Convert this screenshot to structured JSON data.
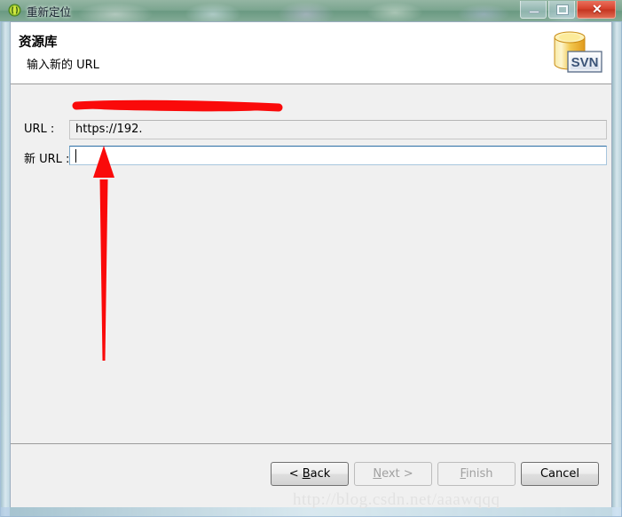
{
  "window": {
    "title": "重新定位",
    "icon": "svn-relocate-icon",
    "controls": {
      "minimize": "minimize-button",
      "maximize": "restore-button",
      "close_glyph": "✕"
    }
  },
  "header": {
    "title": "资源库",
    "subtitle": "输入新的 URL",
    "icon": "svn-repository-icon",
    "icon_label": "SVN"
  },
  "form": {
    "fields": [
      {
        "label": "URL :",
        "value": "https://192.",
        "placeholder": "",
        "readonly": true,
        "redacted": true
      },
      {
        "label": "新 URL :",
        "value": "",
        "placeholder": "",
        "readonly": false,
        "focused": true
      }
    ]
  },
  "annotation": {
    "arrow": "red-up-arrow",
    "color": "#fa0a0a"
  },
  "buttons": [
    {
      "name": "back",
      "prefix": "< ",
      "mnemonic": "B",
      "rest": "ack",
      "suffix": "",
      "enabled": true
    },
    {
      "name": "next",
      "prefix": "",
      "mnemonic": "N",
      "rest": "ext",
      "suffix": " >",
      "enabled": false
    },
    {
      "name": "finish",
      "prefix": "",
      "mnemonic": "F",
      "rest": "inish",
      "suffix": "",
      "enabled": false
    },
    {
      "name": "cancel",
      "prefix": "",
      "mnemonic": "",
      "rest": "Cancel",
      "suffix": "",
      "enabled": true
    }
  ],
  "watermark": "http://blog.csdn.net/aaawqqq",
  "colors": {
    "accent_red": "#fa0a0a",
    "close_button": "#d6412c",
    "focus_border": "#2b6ea5",
    "dialog_bg": "#f0f0f0",
    "header_bg": "#ffffff"
  }
}
